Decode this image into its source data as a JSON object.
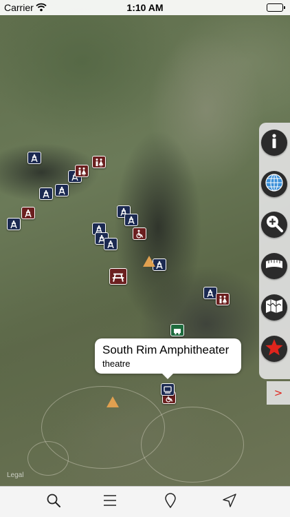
{
  "status_bar": {
    "carrier": "Carrier",
    "time": "1:10 AM",
    "wifi_icon": "wifi-icon",
    "battery_icon": "battery-icon"
  },
  "map": {
    "legal_label": "Legal",
    "markers": [
      {
        "type": "lookout-tower",
        "color": "#1c2a52"
      },
      {
        "type": "restroom",
        "color": "#6b1f1f"
      },
      {
        "type": "accessible",
        "color": "#6b1f1f"
      },
      {
        "type": "picnic-area",
        "color": "#6b1f1f"
      },
      {
        "type": "camping",
        "color": "#e0a050"
      },
      {
        "type": "campground",
        "color": "#1e6b3e"
      },
      {
        "type": "amphitheater",
        "color": "#1c2a52"
      }
    ]
  },
  "callout": {
    "title": "South Rim Amphitheater",
    "subtitle": "theatre"
  },
  "side_toolbar": {
    "buttons": [
      {
        "name": "info-icon"
      },
      {
        "name": "globe-icon"
      },
      {
        "name": "zoom-in-icon"
      },
      {
        "name": "ruler-icon"
      },
      {
        "name": "folded-map-icon"
      },
      {
        "name": "star-icon"
      }
    ],
    "expand_label": ">",
    "accent_color": "#e0241c"
  },
  "tab_bar": {
    "items": [
      {
        "name": "search-icon"
      },
      {
        "name": "list-icon"
      },
      {
        "name": "map-pin-icon"
      },
      {
        "name": "location-arrow-icon"
      }
    ]
  }
}
